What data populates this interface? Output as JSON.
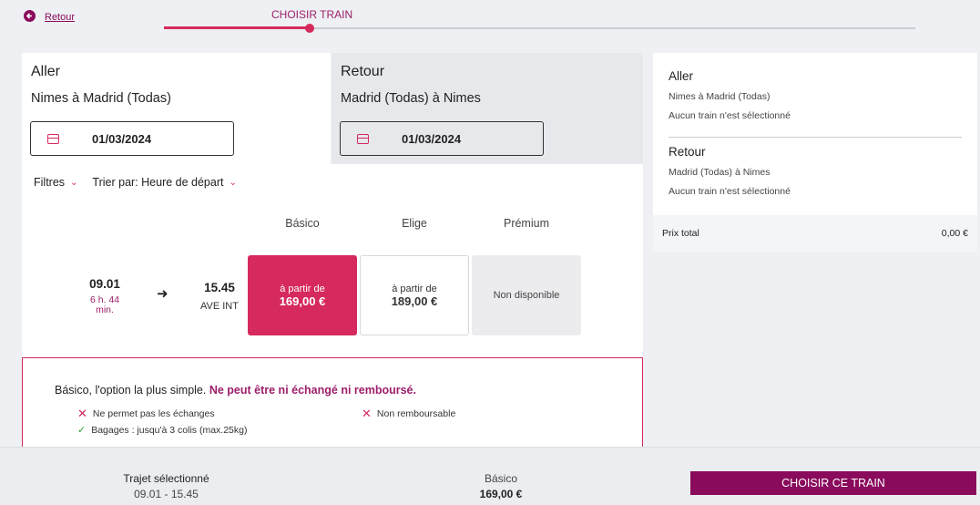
{
  "header": {
    "back_label": "Retour",
    "step_title": "CHOISIR TRAIN"
  },
  "aller": {
    "title": "Aller",
    "route": "Nimes à Madrid (Todas)",
    "date": "01/03/2024"
  },
  "retour": {
    "title": "Retour",
    "route": "Madrid (Todas) à Nimes",
    "date": "01/03/2024"
  },
  "filters": {
    "filtres": "Filtres",
    "sort": "Trier par: Heure de départ"
  },
  "classes": [
    "Básico",
    "Elige",
    "Prémium"
  ],
  "train": {
    "departure": "09.01",
    "duration": "6 h. 44 min.",
    "arrival": "15.45",
    "type": "AVE INT",
    "fares": [
      {
        "prefix": "à partir de",
        "price": "169,00 €"
      },
      {
        "prefix": "à partir de",
        "price": "189,00 €"
      },
      {
        "label": "Non disponible"
      }
    ]
  },
  "details": {
    "intro": "Básico, l'option la plus simple.",
    "warning": "Ne peut être ni échangé ni remboursé.",
    "features": [
      "Ne permet pas les échanges",
      "Non remboursable",
      "Bagages : jusqu'à 3 colis (max.25kg)"
    ]
  },
  "summary": {
    "aller_title": "Aller",
    "aller_route": "Nimes à Madrid (Todas)",
    "aller_status": "Aucun train n'est sélectionné",
    "retour_title": "Retour",
    "retour_route": "Madrid (Todas) à Nimes",
    "retour_status": "Aucun train n'est sélectionné",
    "total_label": "Prix total",
    "total_value": "0,00 €"
  },
  "bottom": {
    "trajet_label": "Trajet sélectionné",
    "trajet_value": "09.01 - 15.45",
    "fare_label": "Básico",
    "fare_price": "169,00 €",
    "cta": "CHOISIR CE TRAIN"
  },
  "colors": {
    "accent": "#d6295d",
    "brand": "#8a0a5c"
  }
}
